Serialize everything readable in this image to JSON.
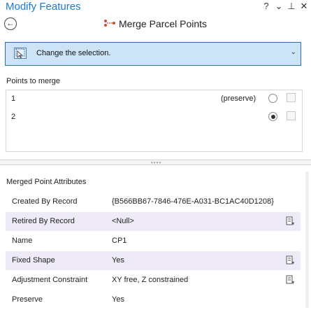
{
  "window": {
    "title": "Modify Features",
    "controls": [
      "?",
      "⌄",
      "⊥",
      "✕"
    ]
  },
  "tool": {
    "title": "Merge Parcel Points",
    "back_icon": "back-arrow-icon",
    "tool_icon": "merge-points-icon"
  },
  "selection": {
    "label": "Change the selection.",
    "icon": "select-features-icon"
  },
  "points": {
    "label": "Points to merge",
    "rows": [
      {
        "num": "1",
        "tag": "(preserve)",
        "selected": false
      },
      {
        "num": "2",
        "tag": "",
        "selected": true
      }
    ]
  },
  "attributes": {
    "label": "Merged Point Attributes",
    "rows": [
      {
        "name": "Created By Record",
        "value": "{B566BB67-7846-476E-A031-BC1AC40D1208}",
        "has_icon": false
      },
      {
        "name": "Retired By Record",
        "value": "<Null>",
        "has_icon": true
      },
      {
        "name": "Name",
        "value": "CP1",
        "has_icon": false
      },
      {
        "name": "Fixed Shape",
        "value": "Yes",
        "has_icon": true
      },
      {
        "name": "Adjustment Constraint",
        "value": "XY free, Z constrained",
        "has_icon": true
      },
      {
        "name": "Preserve",
        "value": "Yes",
        "has_icon": false
      }
    ]
  },
  "colors": {
    "title": "#1a7ad6",
    "selection_bg": "#cde4f7",
    "selection_border": "#2c6fae",
    "alt_row": "#eeeaf7"
  }
}
